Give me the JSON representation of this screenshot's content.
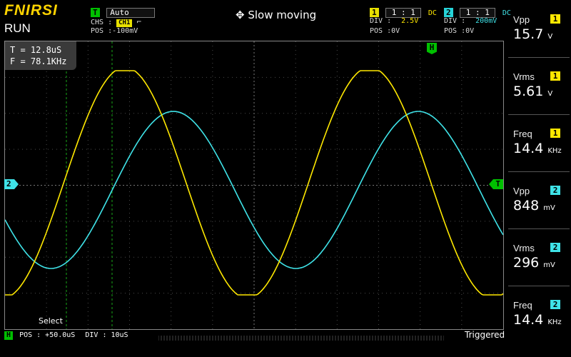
{
  "header": {
    "brand": "FNIRSI",
    "run_state": "RUN",
    "trigger_mode_badge": "T",
    "trigger_mode": "Auto",
    "chs_label": "CHS :",
    "chs_value": "CH1",
    "edge_symbol": "⌠",
    "trig_pos_label": "POS :",
    "trig_pos_value": "-100mV",
    "center_status": "Slow moving",
    "ch1": {
      "badge": "1",
      "probe": "1 : 1",
      "coupling": "DC",
      "div_label": "DIV :",
      "div_value": "2.5V",
      "pos_label": "POS :",
      "pos_value": "0V"
    },
    "ch2": {
      "badge": "2",
      "probe": "1 : 1",
      "coupling": "DC",
      "div_label": "DIV :",
      "div_value": "200mV",
      "pos_label": "POS :",
      "pos_value": "0V"
    }
  },
  "cursor_readout": {
    "t_line": "T = 12.8uS",
    "f_line": "F = 78.1KHz"
  },
  "markers": {
    "h_marker": "H",
    "ch2_marker": "2",
    "trigger_marker": "T"
  },
  "select_label": "Select",
  "measurements": [
    {
      "label": "Vpp",
      "channel": "1",
      "value": "15.7",
      "unit": "V"
    },
    {
      "label": "Vrms",
      "channel": "1",
      "value": "5.61",
      "unit": "V"
    },
    {
      "label": "Freq",
      "channel": "1",
      "value": "14.4",
      "unit": "KHz"
    },
    {
      "label": "Vpp",
      "channel": "2",
      "value": "848",
      "unit": "mV"
    },
    {
      "label": "Vrms",
      "channel": "2",
      "value": "296",
      "unit": "mV"
    },
    {
      "label": "Freq",
      "channel": "2",
      "value": "14.4",
      "unit": "KHz"
    }
  ],
  "footer": {
    "h_badge": "H",
    "pos_text": "POS : +50.0uS",
    "div_text": "DIV : 10uS",
    "status": "Triggered"
  },
  "colors": {
    "ch1": "#ffe800",
    "ch2": "#3fe3e8",
    "grid": "#5a5a5a",
    "brand": "#ffd400"
  }
}
